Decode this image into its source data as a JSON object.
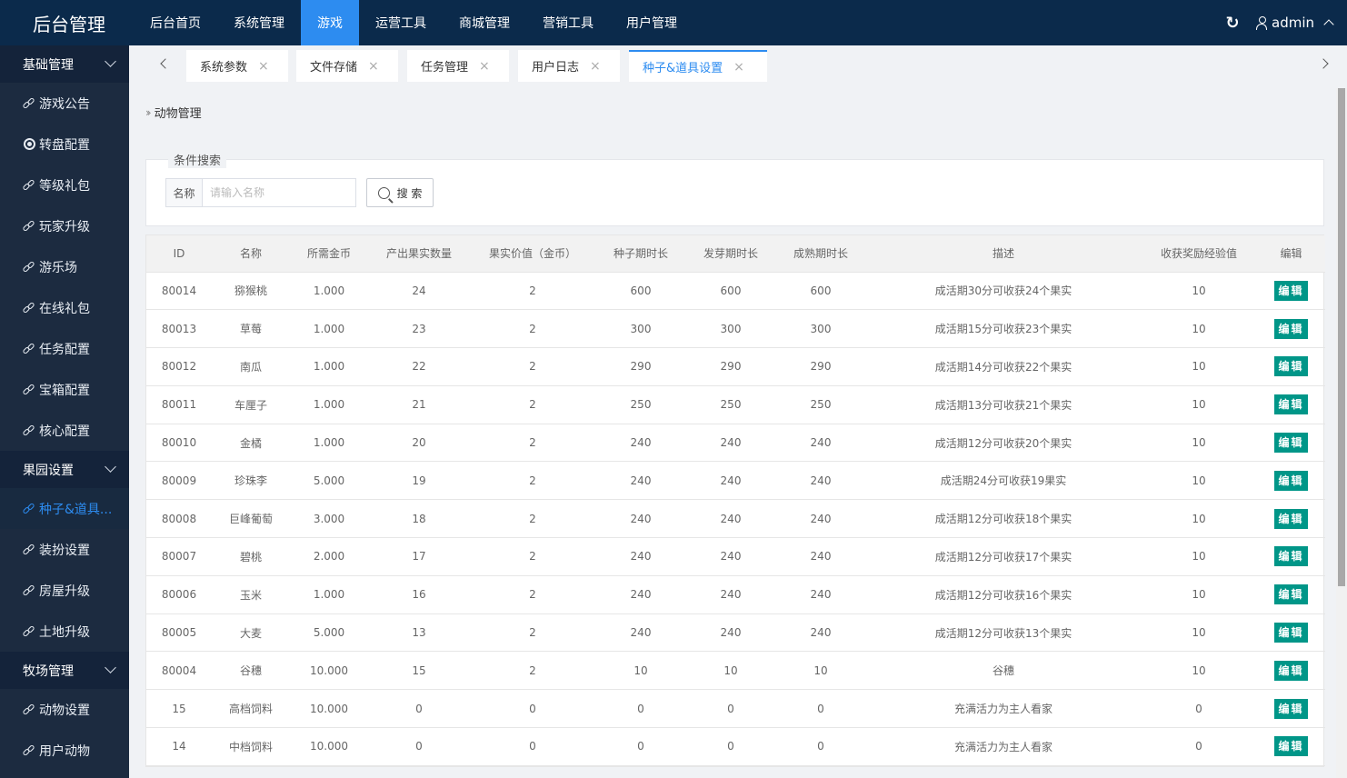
{
  "app": {
    "title": "后台管理"
  },
  "topnav": [
    "后台首页",
    "系统管理",
    "游戏",
    "运营工具",
    "商城管理",
    "营销工具",
    "用户管理"
  ],
  "topnav_active": "游戏",
  "user": {
    "name": "admin"
  },
  "sidebar": {
    "groups": [
      {
        "title": "基础管理",
        "items": [
          {
            "label": "游戏公告",
            "icon": "link-icon"
          },
          {
            "label": "转盘配置",
            "icon": "disc-icon"
          },
          {
            "label": "等级礼包",
            "icon": "link-icon"
          },
          {
            "label": "玩家升级",
            "icon": "link-icon"
          },
          {
            "label": "游乐场",
            "icon": "link-icon"
          },
          {
            "label": "在线礼包",
            "icon": "link-icon"
          },
          {
            "label": "任务配置",
            "icon": "link-icon"
          },
          {
            "label": "宝箱配置",
            "icon": "link-icon"
          },
          {
            "label": "核心配置",
            "icon": "link-icon"
          }
        ]
      },
      {
        "title": "果园设置",
        "items": [
          {
            "label": "种子&道具...",
            "icon": "link-icon",
            "active": true
          },
          {
            "label": "装扮设置",
            "icon": "link-icon"
          },
          {
            "label": "房屋升级",
            "icon": "link-icon"
          },
          {
            "label": "土地升级",
            "icon": "link-icon"
          }
        ]
      },
      {
        "title": "牧场管理",
        "items": [
          {
            "label": "动物设置",
            "icon": "link-icon"
          },
          {
            "label": "用户动物",
            "icon": "link-icon"
          }
        ]
      }
    ]
  },
  "tabs": [
    {
      "label": "系统参数",
      "close": "×"
    },
    {
      "label": "文件存储",
      "close": "×"
    },
    {
      "label": "任务管理",
      "close": "×"
    },
    {
      "label": "用户日志",
      "close": "×"
    },
    {
      "label": "种子&道具设置",
      "close": "×",
      "active": true
    }
  ],
  "breadcrumb": {
    "label": "动物管理"
  },
  "search": {
    "legend": "条件搜索",
    "field_label": "名称",
    "placeholder": "请输入名称",
    "value": "",
    "button_label": "搜 索"
  },
  "table": {
    "columns": [
      "ID",
      "名称",
      "所需金币",
      "产出果实数量",
      "果实价值（金币）",
      "种子期时长",
      "发芽期时长",
      "成熟期时长",
      "描述",
      "收获奖励经验值",
      "编辑"
    ],
    "edit_label": "编辑",
    "rows": [
      [
        "80014",
        "猕猴桃",
        "1.000",
        "24",
        "2",
        "600",
        "600",
        "600",
        "成活期30分可收获24个果实",
        "10"
      ],
      [
        "80013",
        "草莓",
        "1.000",
        "23",
        "2",
        "300",
        "300",
        "300",
        "成活期15分可收获23个果实",
        "10"
      ],
      [
        "80012",
        "南瓜",
        "1.000",
        "22",
        "2",
        "290",
        "290",
        "290",
        "成活期14分可收获22个果实",
        "10"
      ],
      [
        "80011",
        "车厘子",
        "1.000",
        "21",
        "2",
        "250",
        "250",
        "250",
        "成活期13分可收获21个果实",
        "10"
      ],
      [
        "80010",
        "金橘",
        "1.000",
        "20",
        "2",
        "240",
        "240",
        "240",
        "成活期12分可收获20个果实",
        "10"
      ],
      [
        "80009",
        "珍珠李",
        "5.000",
        "19",
        "2",
        "240",
        "240",
        "240",
        "成活期24分可收获19果实",
        "10"
      ],
      [
        "80008",
        "巨峰葡萄",
        "3.000",
        "18",
        "2",
        "240",
        "240",
        "240",
        "成活期12分可收获18个果实",
        "10"
      ],
      [
        "80007",
        "碧桃",
        "2.000",
        "17",
        "2",
        "240",
        "240",
        "240",
        "成活期12分可收获17个果实",
        "10"
      ],
      [
        "80006",
        "玉米",
        "1.000",
        "16",
        "2",
        "240",
        "240",
        "240",
        "成活期12分可收获16个果实",
        "10"
      ],
      [
        "80005",
        "大麦",
        "5.000",
        "13",
        "2",
        "240",
        "240",
        "240",
        "成活期12分可收获13个果实",
        "10"
      ],
      [
        "80004",
        "谷穗",
        "10.000",
        "15",
        "2",
        "10",
        "10",
        "10",
        "谷穗",
        "10"
      ],
      [
        "15",
        "高档饲料",
        "10.000",
        "0",
        "0",
        "0",
        "0",
        "0",
        "充满活力为主人看家",
        "0"
      ],
      [
        "14",
        "中档饲料",
        "10.000",
        "0",
        "0",
        "0",
        "0",
        "0",
        "充满活力为主人看家",
        "0"
      ]
    ]
  }
}
